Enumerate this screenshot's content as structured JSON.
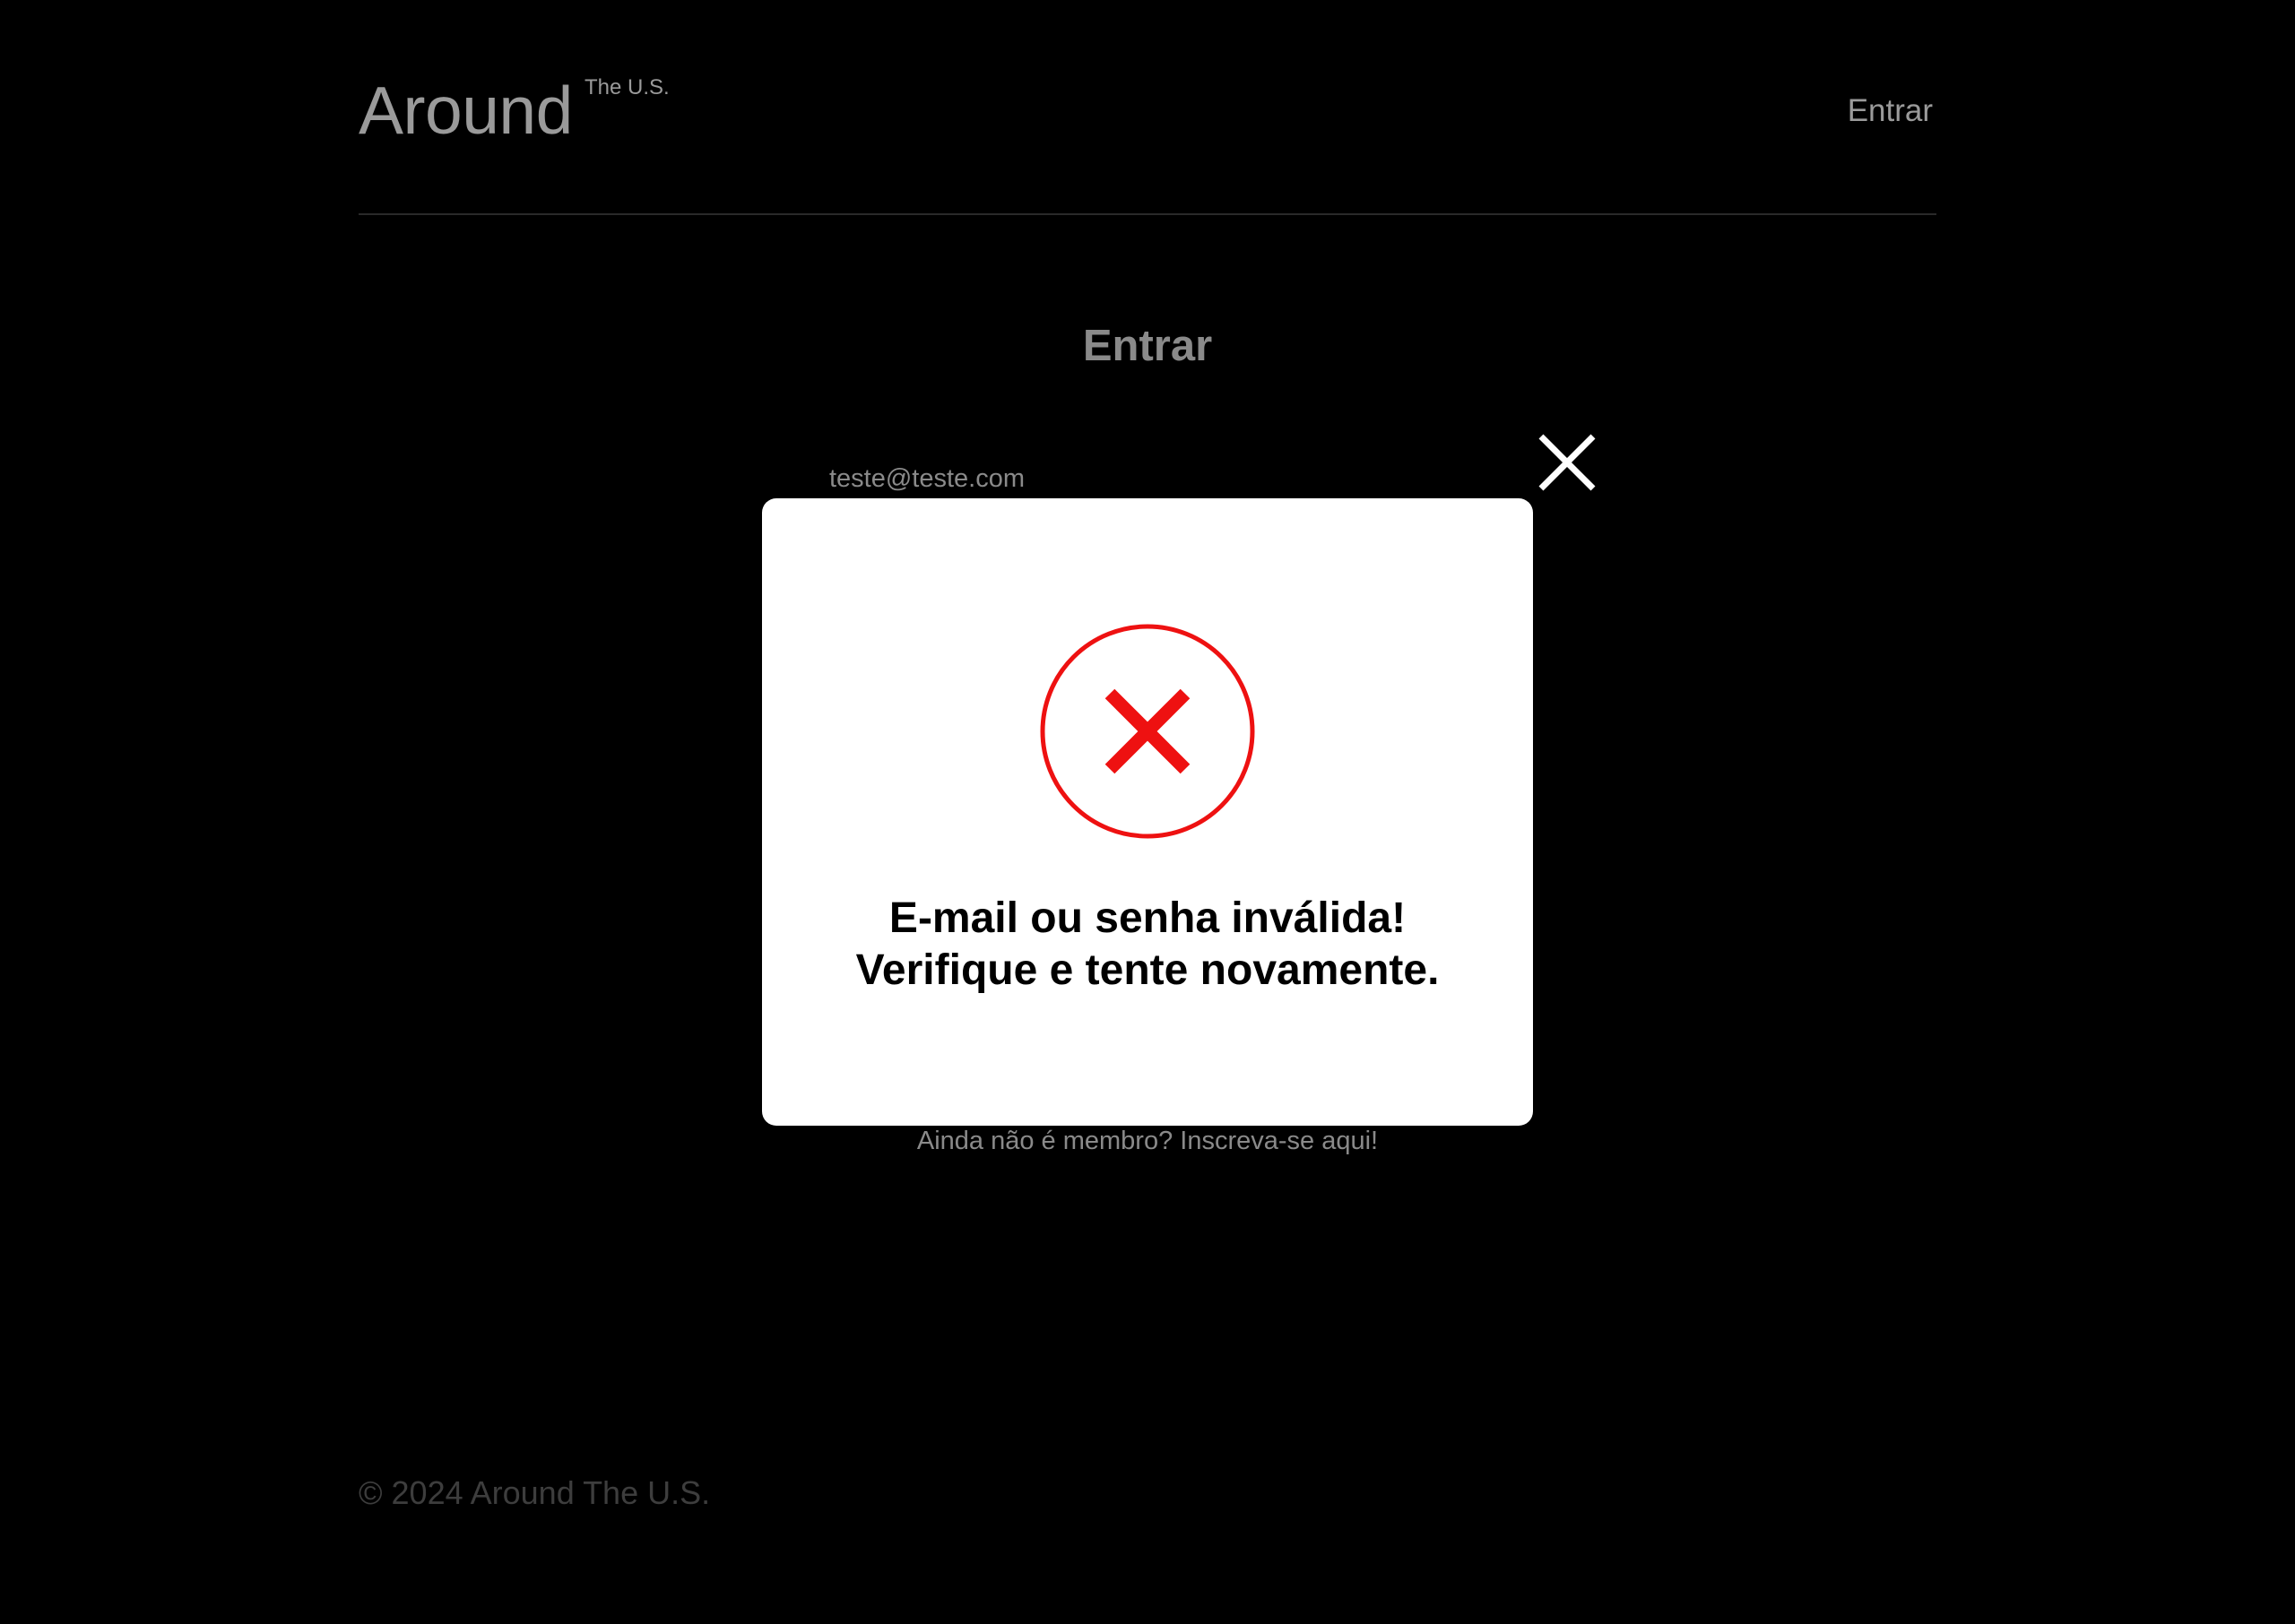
{
  "header": {
    "logo_text": "Around",
    "logo_superscript": "The U.S.",
    "login_link": "Entrar"
  },
  "form": {
    "title": "Entrar",
    "email_value": "teste@teste.com",
    "signup_link": "Ainda não é membro? Inscreva-se aqui!"
  },
  "footer": {
    "copyright": "© 2024 Around The U.S."
  },
  "modal": {
    "icon": "error-x-circle-icon",
    "icon_color": "#ee1111",
    "message_line1": "E-mail ou senha inválida!",
    "message_line2": "Verifique e tente novamente.",
    "close_icon": "close-icon"
  }
}
